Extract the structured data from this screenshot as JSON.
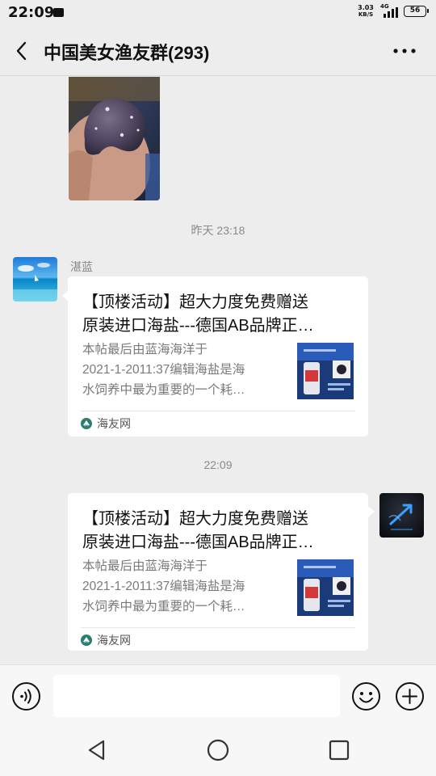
{
  "status_bar": {
    "time": "22:09",
    "net_speed": "3.03",
    "net_unit": "KB/S",
    "network": "4G",
    "battery": "56"
  },
  "header": {
    "title": "中国美女渔友群(293)",
    "back_icon": "chevron-left-icon",
    "more_icon": "more-dots-icon"
  },
  "messages": {
    "timestamp_1": "昨天 23:18",
    "sender_1": "湛蓝",
    "card_1": {
      "title_line1": "【顶楼活动】超大力度免费赠送",
      "title_line2": "原装进口海盐---德国AB品牌正…",
      "desc_line1": "本帖最后由蓝海海洋于",
      "desc_line2": "2021-1-2011:37编辑海盐是海",
      "desc_line3": "水饲养中最为重要的一个耗…",
      "source": "海友网"
    },
    "timestamp_2": "22:09",
    "card_2": {
      "title_line1": "【顶楼活动】超大力度免费赠送",
      "title_line2": "原装进口海盐---德国AB品牌正…",
      "desc_line1": "本帖最后由蓝海海洋于",
      "desc_line2": "2021-1-2011:37编辑海盐是海",
      "desc_line3": "水饲养中最为重要的一个耗…",
      "source": "海友网"
    }
  },
  "input_bar": {
    "placeholder": "",
    "voice_icon": "voice-icon",
    "emoji_icon": "emoji-icon",
    "plus_icon": "plus-icon"
  },
  "nav_bar": {
    "back_icon": "triangle-back-icon",
    "home_icon": "circle-home-icon",
    "recents_icon": "square-recents-icon"
  },
  "colors": {
    "background": "#ededed",
    "bubble": "#ffffff",
    "timestamp_text": "#8a8a8a"
  }
}
